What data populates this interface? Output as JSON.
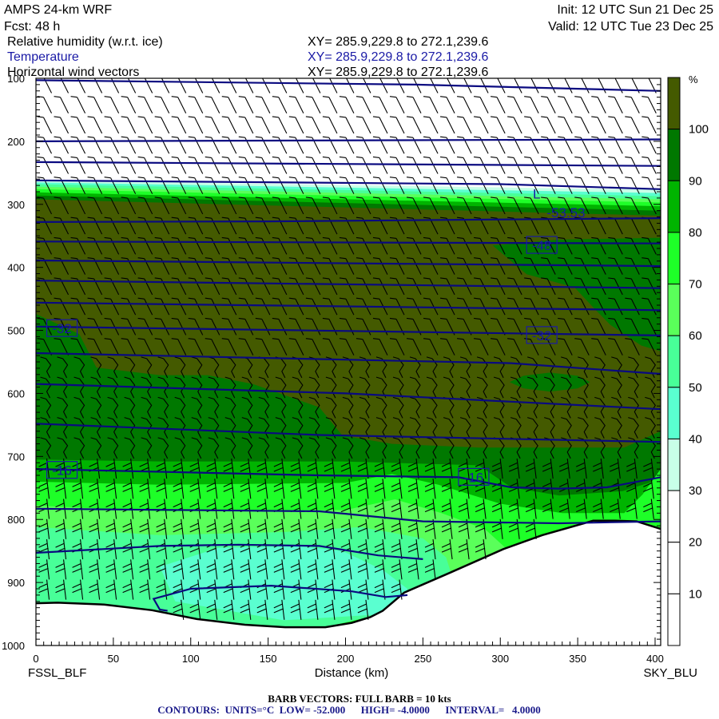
{
  "header": {
    "model": "AMPS 24-km WRF",
    "fcst": "Fcst:   48 h",
    "init": "Init: 12 UTC Sun 21 Dec 25",
    "valid": "Valid: 12 UTC Tue 23 Dec 25"
  },
  "fields": [
    {
      "name": "Relative humidity (w.r.t. ice)",
      "xy": "XY= 285.9,229.8 to 272.1,239.6",
      "color": "#000000"
    },
    {
      "name": "Temperature",
      "xy": "XY= 285.9,229.8 to 272.1,239.6",
      "color": "#1a1aa6"
    },
    {
      "name": "Horizontal wind vectors",
      "xy": "XY= 285.9,229.8 to 272.1,239.6",
      "color": "#000000"
    }
  ],
  "footer": {
    "barb": "BARB VECTORS:  FULL BARB = 10 kts",
    "contours": "CONTOURS:  UNITS=°C  LOW= -52.000      HIGH= -4.0000      INTERVAL=   4.0000"
  },
  "chart_data": {
    "type": "heatmap",
    "title": "Cross section: relative humidity, temperature, wind",
    "xlabel": "Distance (km)",
    "left_station": "FSSL_BLF",
    "right_station": "SKY_BLU",
    "xlim": [
      0,
      403.6
    ],
    "ylim": [
      100,
      1000
    ],
    "y_inverted": true,
    "x_ticks": [
      "0",
      "50",
      "100",
      "150",
      "200",
      "250",
      "300",
      "350",
      "400"
    ],
    "y_ticks": [
      "100",
      "200",
      "300",
      "400",
      "500",
      "600",
      "700",
      "800",
      "900",
      "1000"
    ],
    "colorbar": {
      "unit": "%",
      "labels": [
        "100",
        "90",
        "80",
        "70",
        "60",
        "50",
        "40",
        "30",
        "20",
        "10"
      ],
      "colors": [
        "#445a00",
        "#007800",
        "#00b400",
        "#1eff28",
        "#5aff5a",
        "#48ff98",
        "#5affd0",
        "#c8ffe8",
        "#ffffff",
        "#ffffff",
        "#ffffff"
      ]
    },
    "rh_regions": [
      {
        "rh_min": 30,
        "color": "#c8ffe8",
        "polygon": [
          [
            0,
            262
          ],
          [
            403.6,
            277
          ],
          [
            403.6,
            1000
          ],
          [
            0,
            1000
          ]
        ]
      },
      {
        "rh_min": 40,
        "color": "#5affd0",
        "polygon": [
          [
            0,
            265
          ],
          [
            403.6,
            282
          ],
          [
            403.6,
            1000
          ],
          [
            0,
            1000
          ]
        ]
      },
      {
        "rh_min": 50,
        "color": "#48ff98",
        "polygon": [
          [
            0,
            268
          ],
          [
            403.6,
            287
          ],
          [
            403.6,
            1000
          ],
          [
            0,
            1000
          ]
        ]
      },
      {
        "rh_min": 60,
        "color": "#5aff5a",
        "polygon": [
          [
            0,
            272
          ],
          [
            403.6,
            292
          ],
          [
            403.6,
            1000
          ],
          [
            0,
            1000
          ]
        ]
      },
      {
        "rh_min": 70,
        "color": "#1eff28",
        "polygon": [
          [
            0,
            276
          ],
          [
            403.6,
            297
          ],
          [
            403.6,
            1000
          ],
          [
            0,
            1000
          ]
        ]
      },
      {
        "rh_min": 80,
        "color": "#00b400",
        "polygon": [
          [
            0,
            281
          ],
          [
            403.6,
            303
          ],
          [
            403.6,
            1000
          ],
          [
            0,
            1000
          ]
        ]
      },
      {
        "rh_min": 90,
        "color": "#007800",
        "polygon": [
          [
            0,
            286
          ],
          [
            403.6,
            310
          ],
          [
            403.6,
            1000
          ],
          [
            0,
            1000
          ]
        ]
      },
      {
        "rh_min": 100,
        "color": "#445a00",
        "polygon": [
          [
            0,
            292
          ],
          [
            403.6,
            318
          ],
          [
            403.6,
            660
          ],
          [
            380,
            686
          ],
          [
            286,
            686
          ],
          [
            230,
            680
          ],
          [
            198,
            667
          ],
          [
            183,
            622
          ],
          [
            140,
            585
          ],
          [
            111,
            571
          ],
          [
            80,
            571
          ],
          [
            39,
            559
          ],
          [
            28,
            506
          ],
          [
            0,
            474
          ]
        ]
      },
      {
        "rh_min": 90,
        "color": "#007800",
        "polygon": [
          [
            295,
            365
          ],
          [
            338,
            356
          ],
          [
            403.6,
            353
          ],
          [
            403.6,
            533
          ],
          [
            391,
            524
          ],
          [
            371,
            491
          ],
          [
            361,
            466
          ],
          [
            348,
            432
          ],
          [
            317,
            411
          ]
        ]
      },
      {
        "rh_min": 90,
        "color": "#007800",
        "polygon": [
          [
            306,
            582
          ],
          [
            315,
            572
          ],
          [
            332,
            567
          ],
          [
            350,
            572
          ],
          [
            358,
            582
          ],
          [
            350,
            592
          ],
          [
            332,
            597
          ],
          [
            315,
            592
          ]
        ]
      },
      {
        "rh_min": 80,
        "color": "#00b400",
        "polygon": [
          [
            0,
            705
          ],
          [
            80,
            708
          ],
          [
            198,
            708
          ],
          [
            286,
            714
          ],
          [
            307,
            749
          ],
          [
            338,
            762
          ],
          [
            379,
            755
          ],
          [
            403.6,
            736
          ],
          [
            403.6,
            1000
          ],
          [
            0,
            1000
          ]
        ]
      },
      {
        "rh_min": 70,
        "color": "#1eff28",
        "polygon": [
          [
            0,
            740
          ],
          [
            80,
            745
          ],
          [
            200,
            742
          ],
          [
            230,
            728
          ],
          [
            260,
            745
          ],
          [
            300,
            775
          ],
          [
            340,
            790
          ],
          [
            380,
            790
          ],
          [
            392,
            760
          ],
          [
            403.6,
            720
          ],
          [
            403.6,
            1000
          ],
          [
            0,
            1000
          ]
        ]
      },
      {
        "rh_min": 60,
        "color": "#5aff5a",
        "polygon": [
          [
            0,
            778
          ],
          [
            80,
            787
          ],
          [
            200,
            785
          ],
          [
            232,
            768
          ],
          [
            262,
            790
          ],
          [
            290,
            815
          ],
          [
            310,
            860
          ],
          [
            320,
            1000
          ],
          [
            0,
            1000
          ],
          [
            0,
            945
          ],
          [
            90,
            950
          ],
          [
            200,
            985
          ],
          [
            220,
            940
          ],
          [
            240,
            905
          ],
          [
            0,
            930
          ]
        ]
      },
      {
        "rh_min": 50,
        "color": "#48ff98",
        "polygon": [
          [
            0,
            812
          ],
          [
            80,
            825
          ],
          [
            160,
            820
          ],
          [
            210,
            812
          ],
          [
            250,
            830
          ],
          [
            265,
            860
          ],
          [
            270,
            900
          ],
          [
            240,
            940
          ],
          [
            180,
            975
          ],
          [
            80,
            955
          ],
          [
            0,
            935
          ]
        ]
      },
      {
        "rh_min": 40,
        "color": "#5affd0",
        "polygon": [
          [
            80,
            875
          ],
          [
            118,
            845
          ],
          [
            170,
            842
          ],
          [
            198,
            850
          ],
          [
            224,
            880
          ],
          [
            240,
            910
          ],
          [
            240,
            948
          ],
          [
            160,
            960
          ],
          [
            90,
            930
          ]
        ]
      }
    ],
    "terrain": [
      [
        0,
        933
      ],
      [
        14,
        932
      ],
      [
        44,
        935
      ],
      [
        75,
        944
      ],
      [
        104,
        958
      ],
      [
        135,
        967
      ],
      [
        161,
        971
      ],
      [
        187,
        971
      ],
      [
        204,
        964
      ],
      [
        216,
        955
      ],
      [
        224,
        945
      ],
      [
        238,
        916
      ],
      [
        267,
        885
      ],
      [
        302,
        847
      ],
      [
        327,
        825
      ],
      [
        360,
        802
      ],
      [
        374,
        802
      ],
      [
        388,
        803
      ],
      [
        403.6,
        815
      ]
    ],
    "temperature_contours": [
      {
        "points": [
          [
            0,
            103
          ],
          [
            245,
            110
          ],
          [
            403.6,
            120
          ]
        ]
      },
      {
        "points": [
          [
            0,
            200
          ],
          [
            403.6,
            197
          ]
        ]
      },
      {
        "points": [
          [
            0,
            233
          ],
          [
            403.6,
            239
          ]
        ]
      },
      {
        "points": [
          [
            0,
            262
          ],
          [
            300,
            268
          ],
          [
            403.6,
            276
          ]
        ]
      },
      {
        "points": [
          [
            0,
            328
          ],
          [
            150,
            327
          ],
          [
            403.6,
            322
          ]
        ]
      },
      {
        "points": [
          [
            0,
            359
          ],
          [
            403.6,
            362
          ]
        ]
      },
      {
        "points": [
          [
            0,
            389
          ],
          [
            403.6,
            398
          ]
        ]
      },
      {
        "points": [
          [
            0,
            421
          ],
          [
            403.6,
            433
          ]
        ]
      },
      {
        "points": [
          [
            0,
            456
          ],
          [
            403.6,
            468
          ]
        ]
      },
      {
        "points": [
          [
            0,
            494
          ],
          [
            403.6,
            508
          ]
        ]
      },
      {
        "points": [
          [
            0,
            536
          ],
          [
            307,
            552
          ],
          [
            403.6,
            569
          ]
        ]
      },
      {
        "points": [
          [
            0,
            585
          ],
          [
            200,
            600
          ],
          [
            403.6,
            625
          ]
        ]
      },
      {
        "points": [
          [
            0,
            648
          ],
          [
            183,
            666
          ],
          [
            403.6,
            677
          ]
        ]
      },
      {
        "points": [
          [
            0,
            720
          ],
          [
            183,
            730
          ],
          [
            273,
            733
          ],
          [
            307,
            749
          ],
          [
            338,
            751
          ],
          [
            369,
            749
          ],
          [
            403.6,
            733
          ]
        ]
      },
      {
        "points": [
          [
            0,
            783
          ],
          [
            183,
            787
          ],
          [
            200,
            791
          ],
          [
            250,
            803
          ],
          [
            338,
            806
          ],
          [
            403.6,
            803
          ]
        ]
      },
      {
        "points": [
          [
            0,
            853
          ],
          [
            80,
            842
          ],
          [
            131,
            840
          ],
          [
            183,
            842
          ],
          [
            221,
            857
          ],
          [
            250,
            863
          ]
        ]
      },
      {
        "points": [
          [
            85,
            945
          ],
          [
            80,
            943
          ],
          [
            76,
            926
          ],
          [
            100,
            910
          ],
          [
            152,
            905
          ],
          [
            204,
            914
          ],
          [
            226,
            923
          ],
          [
            240,
            920
          ]
        ]
      }
    ],
    "contour_labels": [
      {
        "text": "-32",
        "km": 7,
        "mb": 497,
        "boxed": true
      },
      {
        "text": "-16",
        "km": 7,
        "mb": 722,
        "boxed": true
      },
      {
        "text": "-48",
        "km": 317,
        "mb": 365,
        "boxed": true
      },
      {
        "text": "-32",
        "km": 317,
        "mb": 508,
        "boxed": true
      },
      {
        "text": "-16",
        "km": 273,
        "mb": 733,
        "boxed": true
      },
      {
        "text": "L",
        "km": 321,
        "mb": 283,
        "boxed": false
      },
      {
        "text": "-53.53",
        "km": 330,
        "mb": 313,
        "boxed": false
      }
    ]
  }
}
